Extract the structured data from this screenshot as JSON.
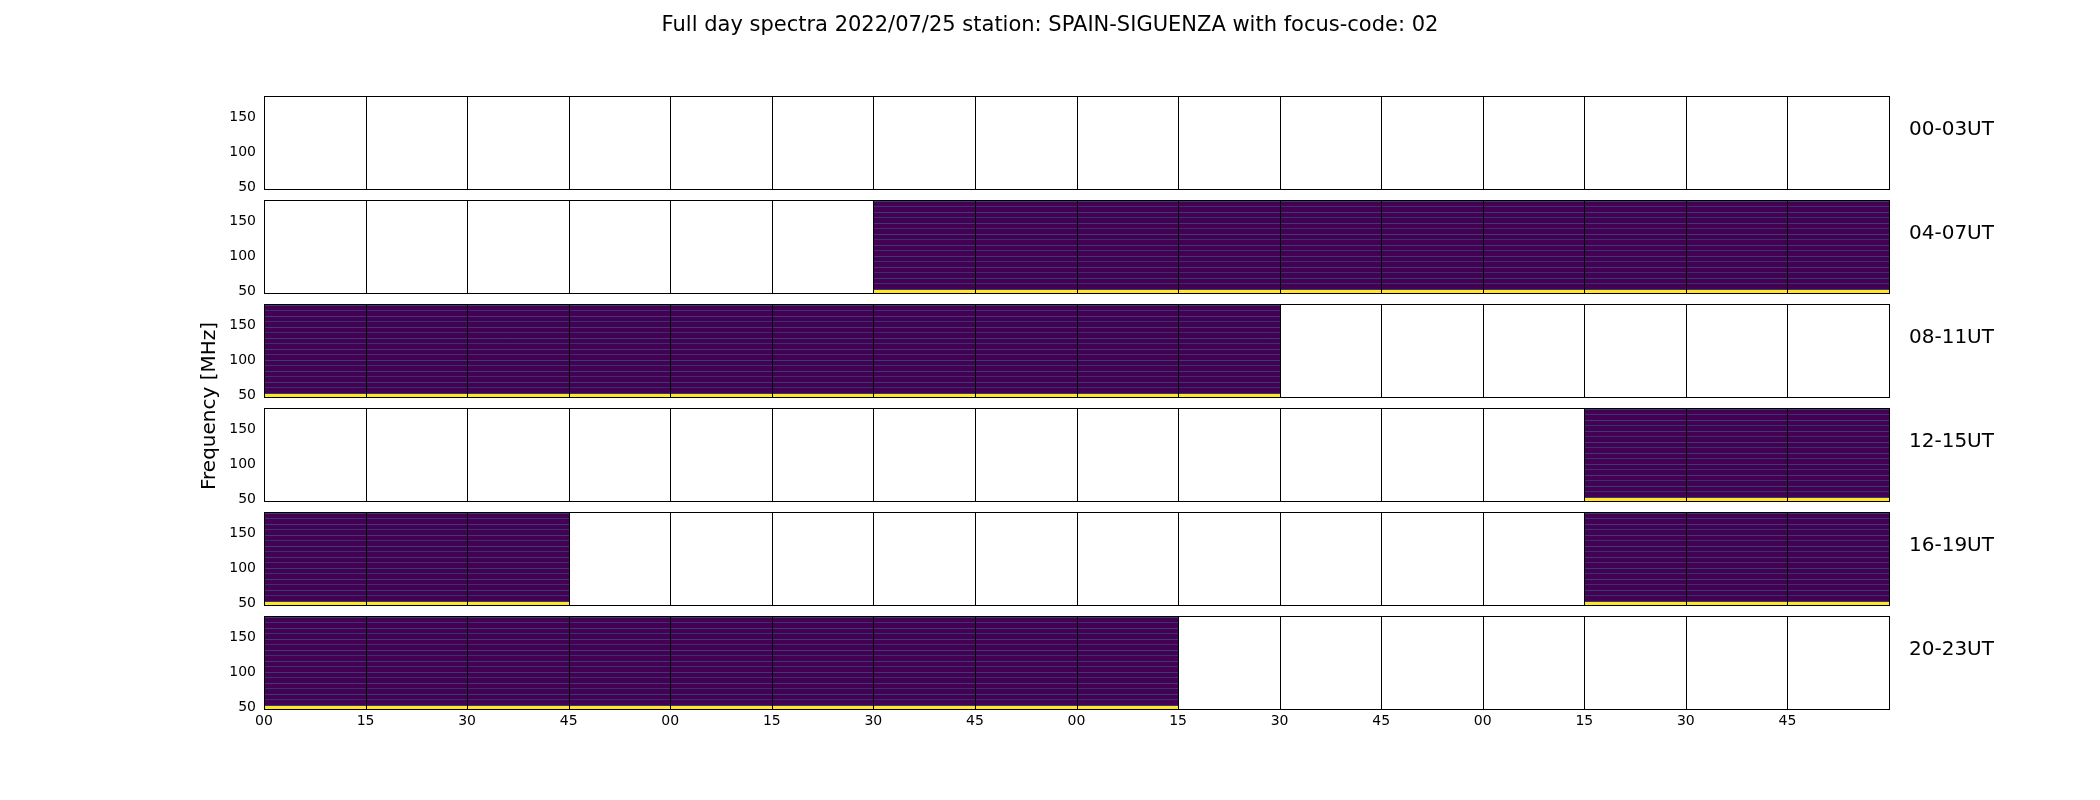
{
  "title": "Full day spectra 2022/07/25 station: SPAIN-SIGUENZA with focus-code: 02",
  "ylabel": "Frequency [MHz]",
  "xticks": [
    "00",
    "15",
    "30",
    "45",
    "00",
    "15",
    "30",
    "45",
    "00",
    "15",
    "30",
    "45",
    "00",
    "15",
    "30",
    "45"
  ],
  "rows": [
    {
      "label": "00-03UT",
      "yticks": [
        "150",
        "100",
        "50"
      ],
      "panels": [
        {
          "filled": false
        },
        {
          "filled": false
        },
        {
          "filled": false
        },
        {
          "filled": false
        },
        {
          "filled": false
        },
        {
          "filled": false
        },
        {
          "filled": false
        },
        {
          "filled": false
        },
        {
          "filled": false
        },
        {
          "filled": false
        },
        {
          "filled": false
        },
        {
          "filled": false
        },
        {
          "filled": false
        },
        {
          "filled": false
        },
        {
          "filled": false
        },
        {
          "filled": false
        }
      ]
    },
    {
      "label": "04-07UT",
      "yticks": [
        "150",
        "100",
        "50"
      ],
      "panels": [
        {
          "filled": false
        },
        {
          "filled": false
        },
        {
          "filled": false
        },
        {
          "filled": false
        },
        {
          "filled": false
        },
        {
          "filled": false
        },
        {
          "filled": true
        },
        {
          "filled": true
        },
        {
          "filled": true
        },
        {
          "filled": true
        },
        {
          "filled": true
        },
        {
          "filled": true
        },
        {
          "filled": true
        },
        {
          "filled": true
        },
        {
          "filled": true
        },
        {
          "filled": true
        }
      ]
    },
    {
      "label": "08-11UT",
      "yticks": [
        "150",
        "100",
        "50"
      ],
      "panels": [
        {
          "filled": true
        },
        {
          "filled": true
        },
        {
          "filled": true
        },
        {
          "filled": true
        },
        {
          "filled": true
        },
        {
          "filled": true
        },
        {
          "filled": true
        },
        {
          "filled": true
        },
        {
          "filled": true
        },
        {
          "filled": true
        },
        {
          "filled": false
        },
        {
          "filled": false
        },
        {
          "filled": false
        },
        {
          "filled": false
        },
        {
          "filled": false
        },
        {
          "filled": false
        }
      ]
    },
    {
      "label": "12-15UT",
      "yticks": [
        "150",
        "100",
        "50"
      ],
      "panels": [
        {
          "filled": false
        },
        {
          "filled": false
        },
        {
          "filled": false
        },
        {
          "filled": false
        },
        {
          "filled": false
        },
        {
          "filled": false
        },
        {
          "filled": false
        },
        {
          "filled": false
        },
        {
          "filled": false
        },
        {
          "filled": false
        },
        {
          "filled": false
        },
        {
          "filled": false
        },
        {
          "filled": false
        },
        {
          "filled": true
        },
        {
          "filled": true
        },
        {
          "filled": true
        }
      ]
    },
    {
      "label": "16-19UT",
      "yticks": [
        "150",
        "100",
        "50"
      ],
      "panels": [
        {
          "filled": true
        },
        {
          "filled": true
        },
        {
          "filled": true
        },
        {
          "filled": false
        },
        {
          "filled": false
        },
        {
          "filled": false
        },
        {
          "filled": false
        },
        {
          "filled": false
        },
        {
          "filled": false
        },
        {
          "filled": false
        },
        {
          "filled": false
        },
        {
          "filled": false
        },
        {
          "filled": false
        },
        {
          "filled": true
        },
        {
          "filled": true
        },
        {
          "filled": true
        }
      ]
    },
    {
      "label": "20-23UT",
      "yticks": [
        "150",
        "100",
        "50"
      ],
      "panels": [
        {
          "filled": true
        },
        {
          "filled": true
        },
        {
          "filled": true
        },
        {
          "filled": true
        },
        {
          "filled": true
        },
        {
          "filled": true
        },
        {
          "filled": true
        },
        {
          "filled": true
        },
        {
          "filled": true
        },
        {
          "filled": false
        },
        {
          "filled": false
        },
        {
          "filled": false
        },
        {
          "filled": false
        },
        {
          "filled": false
        },
        {
          "filled": false
        },
        {
          "filled": false
        }
      ]
    }
  ]
}
